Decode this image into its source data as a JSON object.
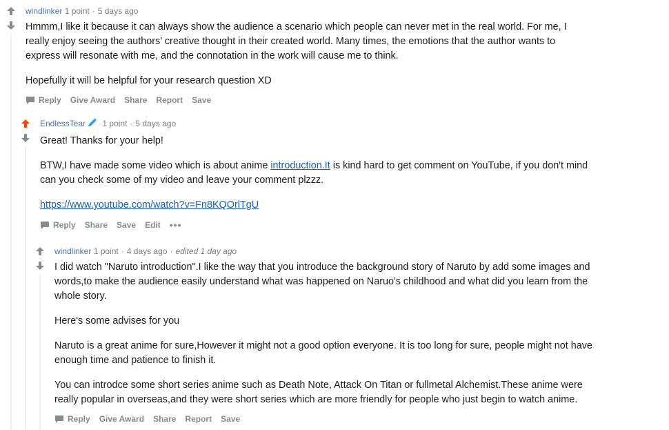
{
  "colors": {
    "author": "#4a74b0",
    "meta": "#7c7c7c",
    "link": "#1a5fb4",
    "action": "#878a8c",
    "upvoted": "#ff4500",
    "thread_line": "#edeff1"
  },
  "comments": [
    {
      "author": "windlinker",
      "points": "1 point",
      "time": "5 days ago",
      "paragraphs": [
        "Hmmm,I like it because it can always show the audience a scenario which people can never met in the real world. For me, I really enjoy seeing the authors’ creative thought in their created world. Many times, the emotions that the author wants to express will resonate with me, and the connotation in the work will cause me to think.",
        "Hopefully it will be helpful for your research question XD"
      ],
      "actions": {
        "reply": "Reply",
        "award": "Give Award",
        "share": "Share",
        "report": "Report",
        "save": "Save"
      }
    },
    {
      "author": "EndlessTear",
      "flair_icon": "pencil-flair-icon",
      "points": "1 point",
      "time": "5 days ago",
      "p1": "Great! Thanks for your help!",
      "p2_before": "BTW,I have made some video which is about anime ",
      "p2_link": "introduction.It",
      "p2_after": " is kind hard to get comment on YouTube, if you don't mind can you check some of my video and leave your comment plzzz.",
      "p3_link": "https://www.youtube.com/watch?v=Fn8KQOrlTgU",
      "actions": {
        "reply": "Reply",
        "share": "Share",
        "save": "Save",
        "edit": "Edit",
        "more": "•••"
      }
    },
    {
      "author": "windlinker",
      "points": "1 point",
      "time": "4 days ago",
      "edited": "edited 1 day ago",
      "paragraphs": [
        "I did watch \"Naruto introduction\".I like the way that you introduce the background story of Naruto by add some images and words,to make the audience easily understand what was happened on Naruo's childhood and what did you learn from the whole story.",
        "Here's some advises for you",
        "Naruto is a great anime for sure,However it might not a good option everyone. It is too long for sure, people might not have enough time and patience to finish it.",
        "You can introdce some short series anime such as Death Note, Attack On Titan or fullmetal Alchemist.These anime were really popular in overseas,and they were short series which are more friendly for people who just begin to watch anime."
      ],
      "actions": {
        "reply": "Reply",
        "award": "Give Award",
        "share": "Share",
        "report": "Report",
        "save": "Save"
      }
    }
  ]
}
